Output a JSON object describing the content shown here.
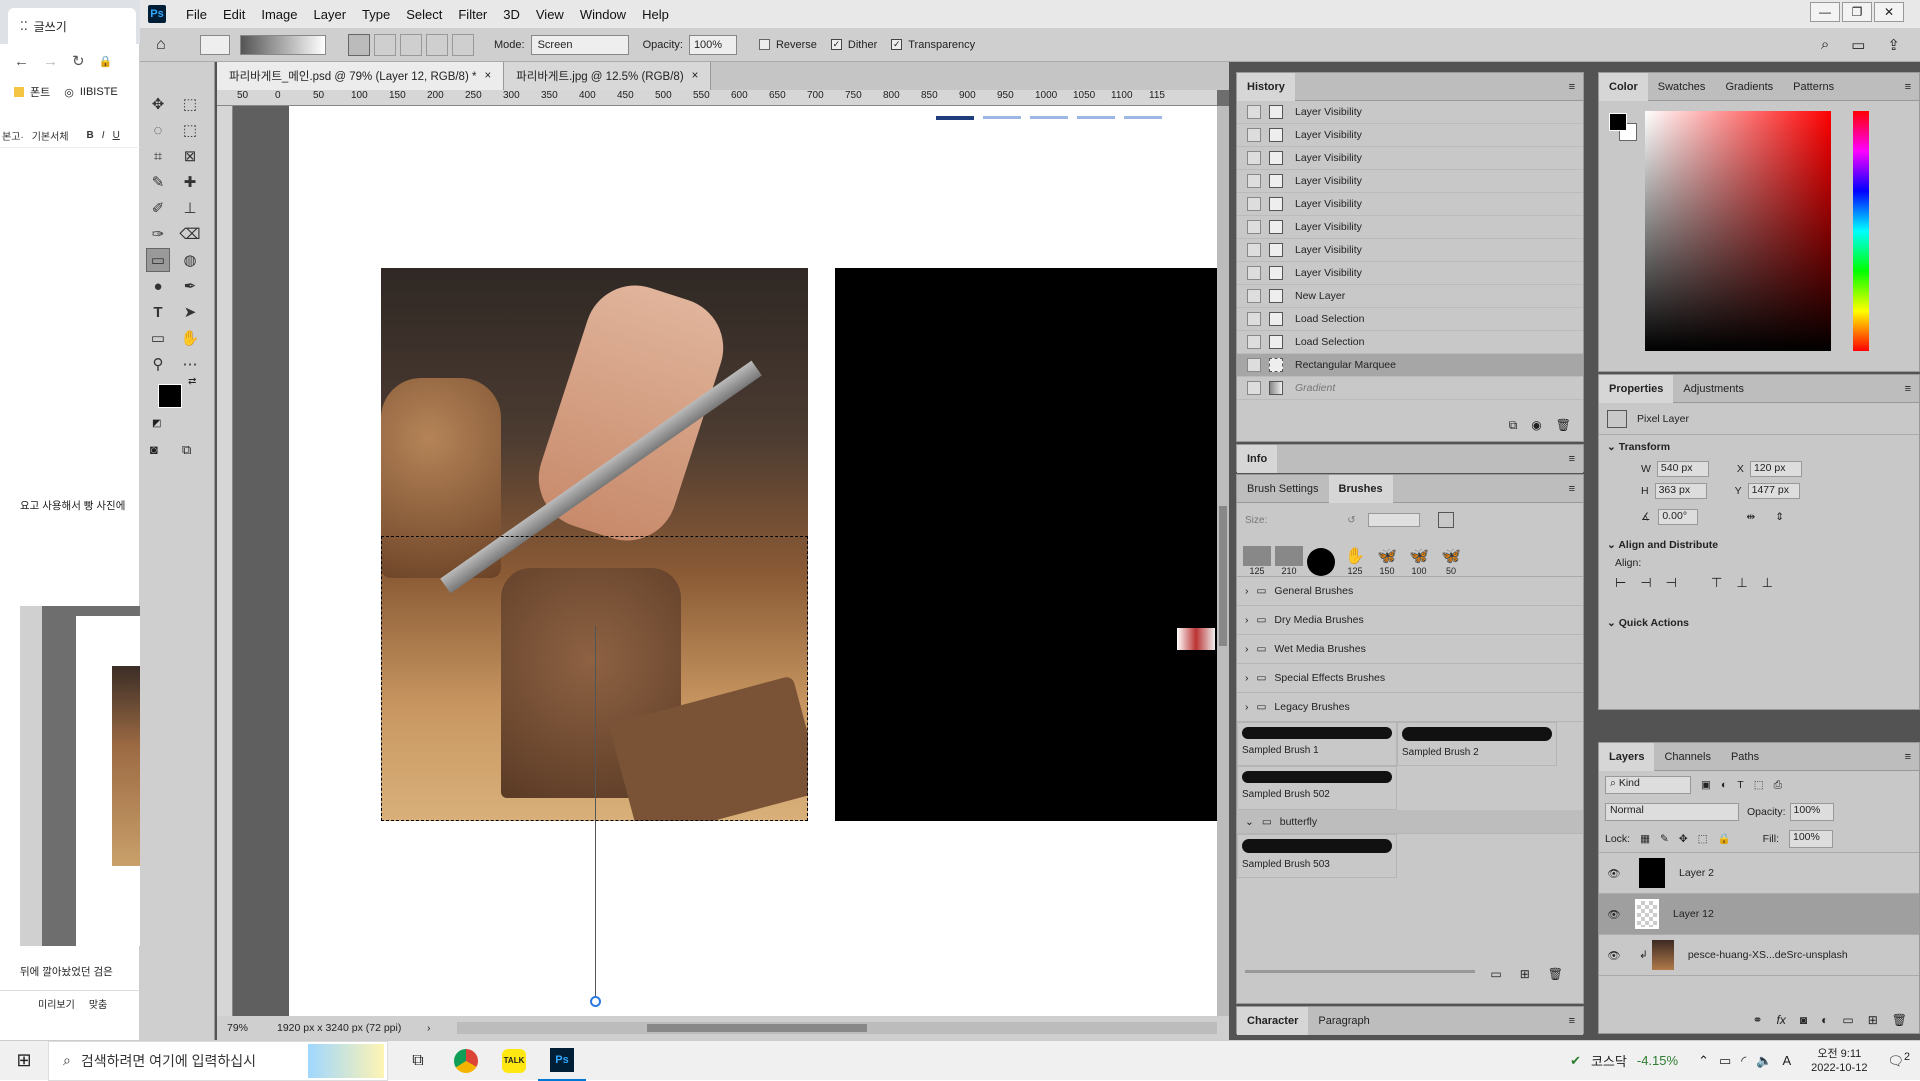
{
  "browser": {
    "tab_title": "글쓰기",
    "bookmark1": "폰트",
    "bookmark2": "IIBISTE",
    "font_select": "본고·",
    "font_name": "기본서체",
    "bold": "B",
    "italic": "I",
    "underline": "U",
    "body_text1": "요고 사용해서 빵 사진에",
    "body_text2": "뒤에 깔아놨었던 검은",
    "preview": "미리보기",
    "save": "맞춤"
  },
  "menu": [
    "File",
    "Edit",
    "Image",
    "Layer",
    "Type",
    "Select",
    "Filter",
    "3D",
    "View",
    "Window",
    "Help"
  ],
  "options": {
    "mode_label": "Mode:",
    "mode_value": "Screen",
    "opacity_label": "Opacity:",
    "opacity_value": "100%",
    "reverse": "Reverse",
    "dither": "Dither",
    "transparency": "Transparency"
  },
  "doc_tabs": [
    "파리바게트_메인.psd @ 79% (Layer 12, RGB/8) *",
    "파리바게트.jpg @ 12.5% (RGB/8)"
  ],
  "ruler_ticks": [
    "50",
    "0",
    "50",
    "100",
    "150",
    "200",
    "250",
    "300",
    "350",
    "400",
    "450",
    "500",
    "550",
    "600",
    "650",
    "700",
    "750",
    "800",
    "850",
    "900",
    "950",
    "1000",
    "1050",
    "1100",
    "115"
  ],
  "status": {
    "zoom": "79%",
    "size": "1920 px x 3240 px (72 ppi)"
  },
  "history": {
    "title": "History",
    "items": [
      "Layer Visibility",
      "Layer Visibility",
      "Layer Visibility",
      "Layer Visibility",
      "Layer Visibility",
      "Layer Visibility",
      "Layer Visibility",
      "Layer Visibility",
      "New Layer",
      "Load Selection",
      "Load Selection",
      "Rectangular Marquee",
      "Gradient"
    ]
  },
  "info": {
    "title": "Info"
  },
  "brushes": {
    "tab1": "Brush Settings",
    "tab2": "Brushes",
    "size_label": "Size:",
    "presets": [
      "125",
      "210",
      "",
      "125",
      "150",
      "100",
      "50"
    ],
    "folders": [
      "General Brushes",
      "Dry Media Brushes",
      "Wet Media Brushes",
      "Special Effects Brushes",
      "Legacy Brushes"
    ],
    "samples": [
      "Sampled Brush 1",
      "Sampled Brush 2",
      "Sampled Brush 502"
    ],
    "folder2": "butterfly",
    "sample4": "Sampled Brush 503"
  },
  "character": {
    "tab1": "Character",
    "tab2": "Paragraph"
  },
  "color": {
    "tabs": [
      "Color",
      "Swatches",
      "Gradients",
      "Patterns"
    ]
  },
  "properties": {
    "tab1": "Properties",
    "tab2": "Adjustments",
    "type": "Pixel Layer",
    "transform": "Transform",
    "w_label": "W",
    "w": "540 px",
    "h_label": "H",
    "h": "363 px",
    "x_label": "X",
    "x": "120 px",
    "y_label": "Y",
    "y": "1477 px",
    "angle": "0.00°",
    "align": "Align and Distribute",
    "align_label": "Align:",
    "quick": "Quick Actions"
  },
  "layers": {
    "tabs": [
      "Layers",
      "Channels",
      "Paths"
    ],
    "kind": "Kind",
    "blend": "Normal",
    "opacity_label": "Opacity:",
    "opacity": "100%",
    "lock": "Lock:",
    "fill_label": "Fill:",
    "fill": "100%",
    "items": [
      "Layer 2",
      "Layer 12",
      "pesce-huang-XS...deSrc-unsplash"
    ]
  },
  "taskbar": {
    "search": "검색하려면 여기에 입력하십시",
    "stock_name": "코스닥",
    "stock_change": "-4.15%",
    "ime": "A",
    "time": "오전 9:11",
    "date": "2022-10-12",
    "notif": "2"
  }
}
